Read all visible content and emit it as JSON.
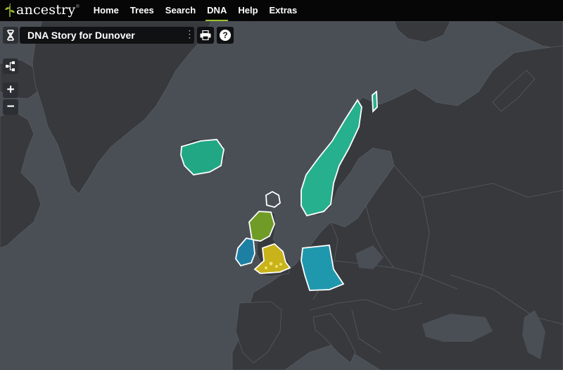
{
  "brand": {
    "name": "ancestry",
    "tm": "®"
  },
  "nav": {
    "items": [
      {
        "label": "Home",
        "active": false
      },
      {
        "label": "Trees",
        "active": false
      },
      {
        "label": "Search",
        "active": false
      },
      {
        "label": "DNA",
        "active": true
      },
      {
        "label": "Help",
        "active": false
      },
      {
        "label": "Extras",
        "active": false
      }
    ]
  },
  "story_bar": {
    "title": "DNA Story for Dunover",
    "help_label": "?"
  },
  "map_controls": {
    "zoom_in": "+",
    "zoom_out": "−"
  },
  "colors": {
    "brand_green": "#9cbe30",
    "land": "#37393d",
    "sea": "#4a4f55",
    "scandinavia": "#27b08e",
    "ireland": "#1d7fa4",
    "scotland": "#6f9b26",
    "england_wales": "#c8b31b",
    "germanic_europe": "#1f98ad",
    "iceland": "#22a785",
    "region_outline": "#ffffff"
  },
  "regions": [
    "scandinavia",
    "iceland",
    "scotland",
    "ireland",
    "england-wales",
    "germanic-europe"
  ]
}
